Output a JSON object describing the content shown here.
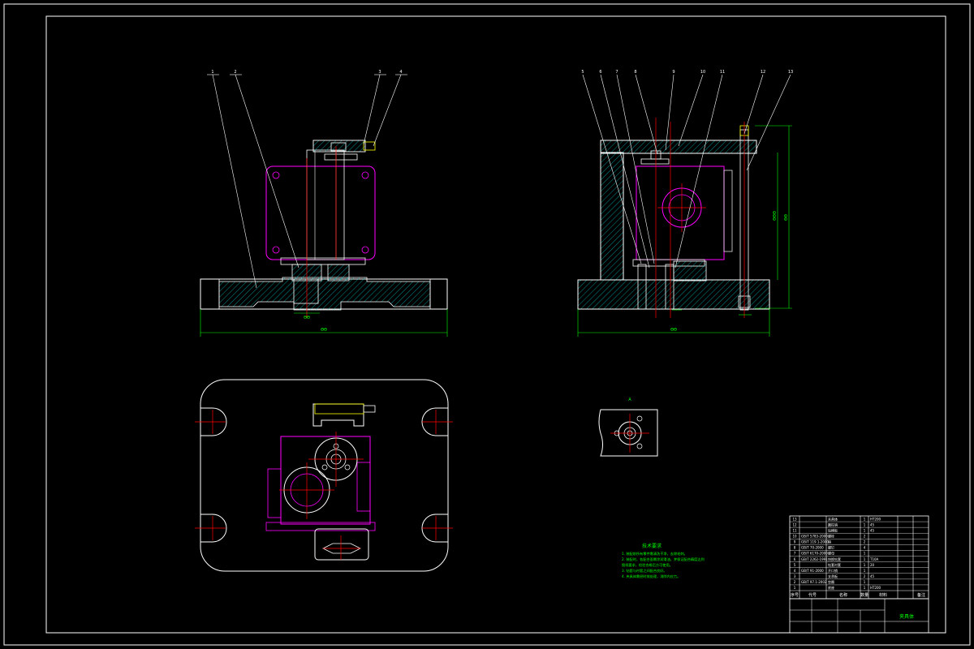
{
  "drawing": {
    "colors": {
      "background": "#000000",
      "outline": "#ffffff",
      "centerline": "#ff0000",
      "hidden_part": "#ff00ff",
      "hatch": "#00cccc",
      "dimension": "#00ff00",
      "leader": "#ffffff",
      "accent": "#ffff00"
    },
    "views": {
      "front": {
        "balloons": [
          "1",
          "2",
          "3",
          "4"
        ],
        "dim_base_width": "ѲѲ",
        "dim_bore": "ѲѲ"
      },
      "side": {
        "balloons": [
          "5",
          "6",
          "7",
          "8",
          "9",
          "10",
          "11",
          "12",
          "13"
        ],
        "dim_base_width": "ѲѲ",
        "dim_total_height": "ѲѲ",
        "dim_inner_height": "ѲѲѲ"
      },
      "top": {
        "label": ""
      },
      "detail": {
        "label": "A"
      }
    },
    "technical_requirements": {
      "title": "技术要求",
      "lines": [
        "1. 装配前所有零件需清洗干净，去除毛刺。",
        "2. 装配时，各配合面需涂润滑油，并保证配合精度达到",
        "   图纸要求，检验合格后方可使用。",
        "3. 钻套与衬套之间配合良好。",
        "4. 夹具体需经时效处理，消除内应力。"
      ]
    },
    "title_block": {
      "drawing_name": "夹具体",
      "header_cols": [
        "序号",
        "代号",
        "名称",
        "数量",
        "材料",
        "备注"
      ],
      "rows": [
        [
          "13",
          "",
          "夹具体",
          "1",
          "HT200",
          ""
        ],
        [
          "12",
          "",
          "圆柱销",
          "1",
          "45",
          ""
        ],
        [
          "11",
          "",
          "钻模板",
          "1",
          "45",
          ""
        ],
        [
          "10",
          "GB/T 5783-2000",
          "螺栓",
          "2",
          "",
          ""
        ],
        [
          "9",
          "GB/T 119.1-2000",
          "销",
          "2",
          "",
          ""
        ],
        [
          "8",
          "GB/T 70-2000",
          "螺钉",
          "4",
          "",
          ""
        ],
        [
          "7",
          "GB/T 6170-2000",
          "螺母",
          "1",
          "",
          ""
        ],
        [
          "6",
          "GB/T 2262-1991",
          "快换钻套",
          "1",
          "T10A",
          ""
        ],
        [
          "5",
          "",
          "钻套衬套",
          "1",
          "20",
          ""
        ],
        [
          "4",
          "GB/T 91-2000",
          "开口销",
          "1",
          "",
          ""
        ],
        [
          "3",
          "",
          "支承板",
          "2",
          "45",
          ""
        ],
        [
          "2",
          "GB/T 97.1-2002",
          "垫圈",
          "1",
          "",
          ""
        ],
        [
          "1",
          "",
          "底座",
          "1",
          "HT200",
          ""
        ]
      ]
    }
  }
}
